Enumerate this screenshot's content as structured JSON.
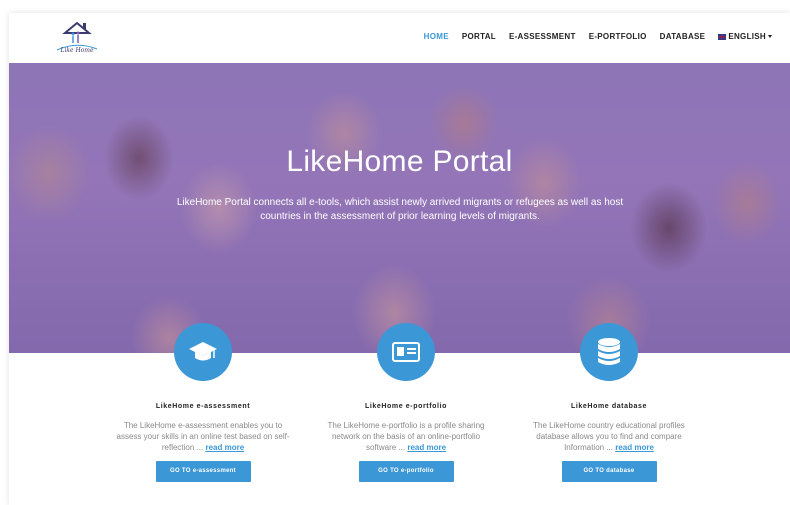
{
  "logo": {
    "text": "Like Home"
  },
  "nav": {
    "items": [
      {
        "label": "HOME",
        "active": true
      },
      {
        "label": "PORTAL",
        "active": false
      },
      {
        "label": "E-ASSESSMENT",
        "active": false
      },
      {
        "label": "E-PORTFOLIO",
        "active": false
      },
      {
        "label": "DATABASE",
        "active": false
      }
    ],
    "language": "ENGLISH"
  },
  "hero": {
    "title": "LikeHome Portal",
    "text": "LikeHome Portal connects all e-tools, which assist newly arrived migrants or refugees as well as host countries in the assessment of prior learning levels of migrants."
  },
  "features": [
    {
      "icon": "graduation-cap-icon",
      "title": "LikeHome e-assessment",
      "text": "The LikeHome e-assessment enables you to assess your skills in an online test based on self-reflection ...",
      "link": "read more",
      "button": "GO TO e-assessment"
    },
    {
      "icon": "id-card-icon",
      "title": "LikeHome e-portfolio",
      "text": "The LikeHome e-portfolio is a profile sharing network on the basis of an online-portfolio software ...",
      "link": "read more",
      "button": "GO TO e-portfolio"
    },
    {
      "icon": "database-icon",
      "title": "LikeHome database",
      "text": "The LikeHome country educational profiles database allows you to find and compare Information ...",
      "link": "read more",
      "button": "GO TO database"
    }
  ],
  "colors": {
    "accent": "#3c97d6",
    "overlay": "#7850be"
  }
}
